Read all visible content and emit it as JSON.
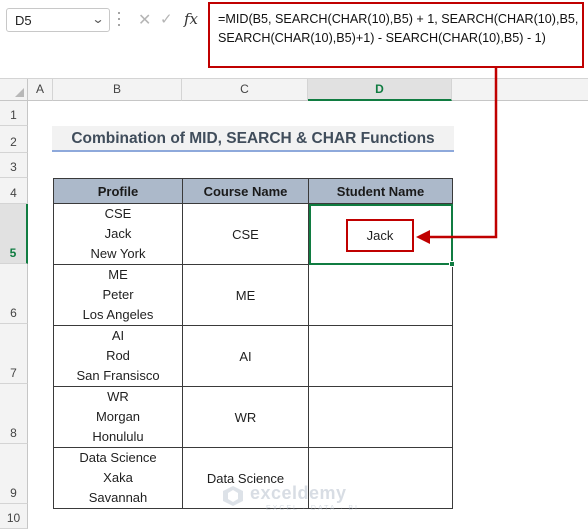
{
  "name_box": {
    "value": "D5"
  },
  "formula_bar": {
    "cancel_glyph": "✕",
    "enter_glyph": "✓",
    "fx_label": "fx",
    "formula": "=MID(B5, SEARCH(CHAR(10),B5) + 1, SEARCH(CHAR(10),B5,\nSEARCH(CHAR(10),B5)+1) - SEARCH(CHAR(10),B5) - 1)"
  },
  "columns": [
    "A",
    "B",
    "C",
    "D"
  ],
  "rows": [
    "1",
    "2",
    "3",
    "4",
    "5",
    "6",
    "7",
    "8",
    "9",
    "10"
  ],
  "active_cell": {
    "column": "D",
    "row": "5"
  },
  "title": "Combination of MID, SEARCH & CHAR Functions",
  "table": {
    "headers": [
      "Profile",
      "Course Name",
      "Student Name"
    ],
    "rows": [
      {
        "profile": [
          "CSE",
          "Jack",
          "New York"
        ],
        "course": "CSE",
        "student": ""
      },
      {
        "profile": [
          "ME",
          "Peter",
          "Los Angeles"
        ],
        "course": "ME",
        "student": ""
      },
      {
        "profile": [
          "AI",
          "Rod",
          "San Fransisco"
        ],
        "course": "AI",
        "student": ""
      },
      {
        "profile": [
          "WR",
          "Morgan",
          "Honululu"
        ],
        "course": "WR",
        "student": ""
      },
      {
        "profile": [
          "Data Science",
          "Xaka",
          "Savannah"
        ],
        "course": "Data Science",
        "student": ""
      }
    ]
  },
  "callout": {
    "result": "Jack"
  },
  "colors": {
    "highlight": "#c00000",
    "accent_green": "#107c41",
    "header_fill": "#acb9ca"
  },
  "watermark": {
    "name": "exceldemy",
    "tagline": "EXCEL · DATA · BI"
  }
}
